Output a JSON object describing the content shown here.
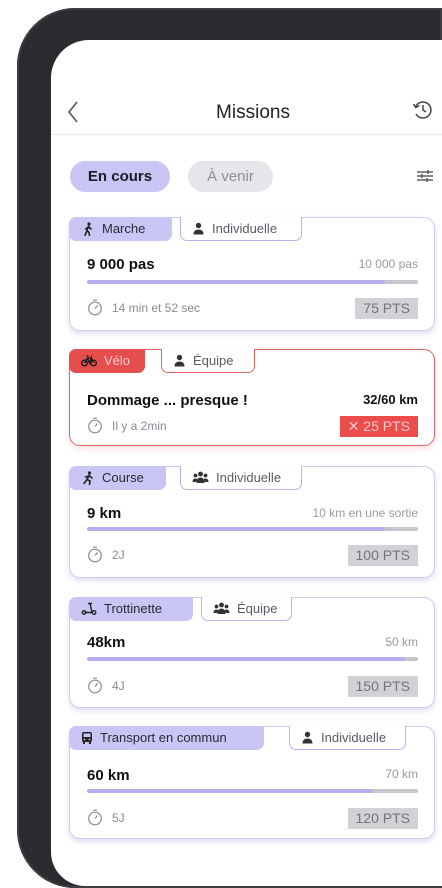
{
  "header": {
    "title": "Missions"
  },
  "tabs": {
    "active": "En cours",
    "inactive": "À venir"
  },
  "missions": [
    {
      "type": "Marche",
      "mode": "Individuelle",
      "value": "9 000 pas",
      "goal": "10 000 pas",
      "progress": 0.9,
      "time": "14 min et 52 sec",
      "points": "75 PTS"
    },
    {
      "type": "Vélo",
      "mode": "Équipe",
      "value": "Dommage ... presque !",
      "score": "32/60 km",
      "time": "Il y a 2min",
      "points": "✕ 25 PTS",
      "status": "failed"
    },
    {
      "type": "Course",
      "mode": "Individuelle",
      "value": "9 km",
      "goal": "10 km en une sortie",
      "progress": 0.9,
      "time": "2J",
      "points": "100 PTS"
    },
    {
      "type": "Trottinette",
      "mode": "Équipe",
      "value": "48km",
      "goal": "50 km",
      "progress": 0.96,
      "time": "4J",
      "points": "150 PTS"
    },
    {
      "type": "Transport en commun",
      "mode": "Individuelle",
      "value": "60 km",
      "goal": "70 km",
      "progress": 0.86,
      "time": "5J",
      "points": "120 PTS"
    }
  ],
  "colors": {
    "accent": "#c9c5f4",
    "danger": "#e64d4d",
    "progress": "#b4aeee"
  },
  "icons": [
    "back-icon",
    "history-icon",
    "filter-icon",
    "walk-icon",
    "bike-icon",
    "run-icon",
    "scooter-icon",
    "bus-icon",
    "person-icon",
    "group-icon",
    "timer-icon"
  ]
}
